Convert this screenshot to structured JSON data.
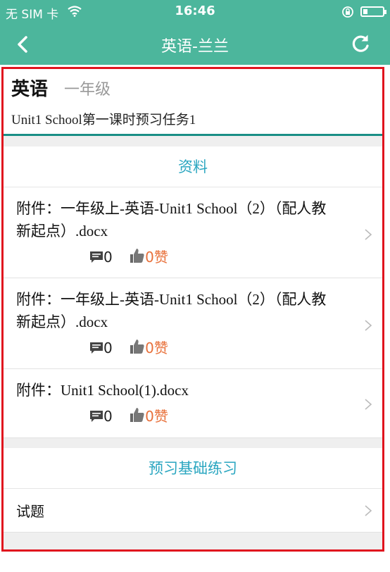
{
  "status_bar": {
    "carrier": "无 SIM 卡",
    "time": "16:46"
  },
  "nav": {
    "title": "英语-兰兰"
  },
  "header": {
    "subject": "英语",
    "grade": "一年级",
    "task_title": "Unit1 School第一课时预习任务1"
  },
  "materials": {
    "title": "资料",
    "items": [
      {
        "line1": "附件：一年级上-英语-Unit1 School（2）（配人教",
        "line2": "新起点）.docx",
        "comments": "0",
        "likes": "0赞"
      },
      {
        "line1": "附件：一年级上-英语-Unit1 School（2）（配人教",
        "line2": "新起点）.docx",
        "comments": "0",
        "likes": "0赞"
      },
      {
        "line1": "附件：Unit1 School(1).docx",
        "line2": "",
        "comments": "0",
        "likes": "0赞"
      }
    ]
  },
  "practice": {
    "title": "预习基础练习",
    "items": [
      {
        "label": "试题"
      }
    ]
  },
  "colors": {
    "header_bg": "#4cb69c",
    "accent_text": "#2aa6c0",
    "like_text": "#e8703a",
    "highlight_border": "#e0141e"
  }
}
